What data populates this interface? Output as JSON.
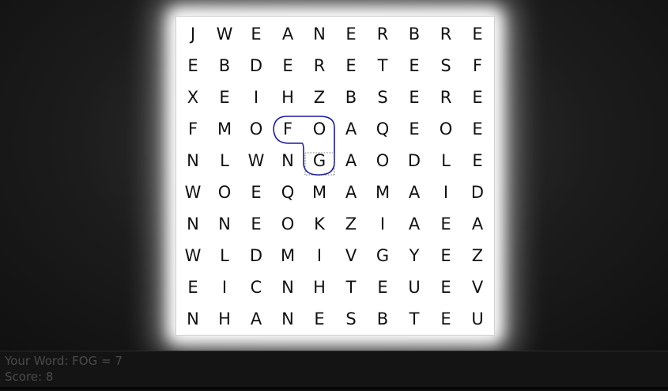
{
  "board": {
    "rows": [
      [
        "J",
        "W",
        "E",
        "A",
        "N",
        "E",
        "R",
        "B",
        "R",
        "E"
      ],
      [
        "E",
        "B",
        "D",
        "E",
        "R",
        "E",
        "T",
        "E",
        "S",
        "F"
      ],
      [
        "X",
        "E",
        "I",
        "H",
        "Z",
        "B",
        "S",
        "E",
        "R",
        "E"
      ],
      [
        "F",
        "M",
        "O",
        "F",
        "O",
        "A",
        "Q",
        "E",
        "O",
        "E"
      ],
      [
        "N",
        "L",
        "W",
        "N",
        "G",
        "A",
        "O",
        "D",
        "L",
        "E"
      ],
      [
        "W",
        "O",
        "E",
        "Q",
        "M",
        "A",
        "M",
        "A",
        "I",
        "D"
      ],
      [
        "N",
        "N",
        "E",
        "O",
        "K",
        "Z",
        "I",
        "A",
        "E",
        "A"
      ],
      [
        "W",
        "L",
        "D",
        "M",
        "I",
        "V",
        "G",
        "Y",
        "E",
        "Z"
      ],
      [
        "E",
        "I",
        "C",
        "N",
        "H",
        "T",
        "E",
        "U",
        "E",
        "V"
      ],
      [
        "N",
        "H",
        "A",
        "N",
        "E",
        "S",
        "B",
        "T",
        "E",
        "U"
      ]
    ],
    "selected_path": [
      [
        3,
        3
      ],
      [
        3,
        4
      ],
      [
        4,
        4
      ]
    ],
    "path_color": "#1a1aa6"
  },
  "status": {
    "word_label": "Your Word: FOG = 7",
    "score_label": "Score: 8"
  }
}
